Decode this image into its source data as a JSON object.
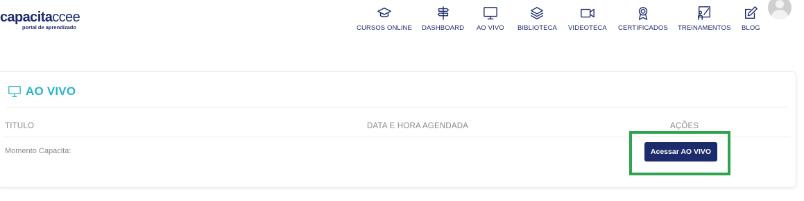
{
  "logo": {
    "brand_bold": "capacita",
    "brand_light": "ccee",
    "tagline": "portal de aprendizado"
  },
  "nav": {
    "items": [
      {
        "label": "CURSOS ONLINE",
        "icon": "graduation-cap-icon"
      },
      {
        "label": "DASHBOARD",
        "icon": "signpost-icon"
      },
      {
        "label": "AO VIVO",
        "icon": "monitor-icon"
      },
      {
        "label": "BIBLIOTECA",
        "icon": "layers-icon"
      },
      {
        "label": "VIDEOTECA",
        "icon": "video-camera-icon"
      },
      {
        "label": "CERTIFICADOS",
        "icon": "award-ribbon-icon"
      },
      {
        "label": "TREINAMENTOS",
        "icon": "presentation-board-icon"
      },
      {
        "label": "BLOG",
        "icon": "edit-pencil-icon"
      }
    ]
  },
  "section": {
    "title": "AO VIVO",
    "icon": "monitor-icon",
    "accent": "#2ab3c9"
  },
  "table": {
    "headers": {
      "title": "TITULO",
      "datetime": "DATA E HORA AGENDADA",
      "actions": "AÇÕES"
    },
    "rows": [
      {
        "title": "Momento Capacita:",
        "datetime": "",
        "action_label": "Acessar AO VIVO"
      }
    ]
  },
  "colors": {
    "brand": "#1b2b6b",
    "highlight": "#2ea44f"
  }
}
